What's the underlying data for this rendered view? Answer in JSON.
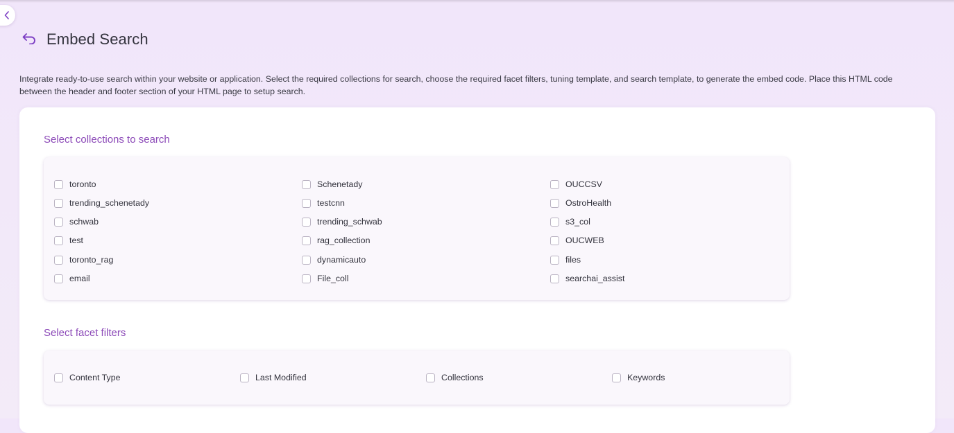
{
  "page": {
    "title": "Embed Search",
    "description_line1": "Integrate ready-to-use search within your website or application. Select the required collections for search, choose the required facet filters, tuning template, and search template, to generate the embed code. Place this HTML code",
    "description_line2": "between the header and footer section of your HTML page to setup search."
  },
  "collections": {
    "title": "Select collections to search",
    "columns": [
      [
        "toronto",
        "trending_schenetady",
        "schwab",
        "test",
        "toronto_rag",
        "email"
      ],
      [
        "Schenetady",
        "testcnn",
        "trending_schwab",
        "rag_collection",
        "dynamicauto",
        "File_coll"
      ],
      [
        "OUCCSV",
        "OstroHealth",
        "s3_col",
        "OUCWEB",
        "files",
        "searchai_assist"
      ]
    ]
  },
  "facets": {
    "title": "Select facet filters",
    "items": [
      "Content Type",
      "Last Modified",
      "Collections",
      "Keywords"
    ]
  },
  "colors": {
    "accent": "#8c4ab8",
    "icon": "#7d3fc4",
    "background": "#f1e6fa"
  }
}
